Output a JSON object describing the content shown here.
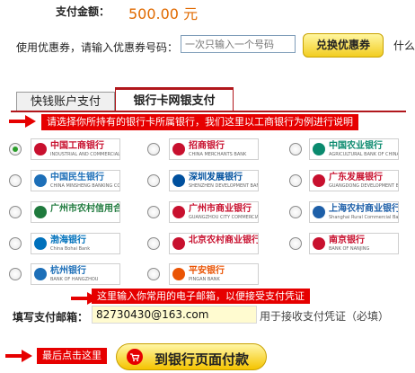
{
  "payment": {
    "label": "支付金额：",
    "amount": "500.00  元"
  },
  "coupon": {
    "label": "使用优惠券，请输入优惠券号码：",
    "placeholder": "一次只输入一个号码",
    "button": "兑换优惠券",
    "more": "什么"
  },
  "tabs": [
    {
      "label": "快钱账户支付"
    },
    {
      "label": "银行卡网银支付"
    }
  ],
  "banners": {
    "choose_bank": "请选择你所持有的银行卡所属银行，我们这里以工商银行为例进行说明",
    "email_tip": "这里输入你常用的电子邮箱，以便接受支付凭证",
    "final_click": "最后点击这里"
  },
  "banks": [
    {
      "name": "中国工商银行",
      "en": "INDUSTRIAL AND COMMERCIAL BANK OF CHINA",
      "color": "#c8102e",
      "selected": true
    },
    {
      "name": "招商银行",
      "en": "CHINA MERCHANTS BANK",
      "color": "#c8102e",
      "selected": false
    },
    {
      "name": "中国农业银行",
      "en": "AGRICULTURAL BANK OF CHINA",
      "color": "#0a8a6e",
      "selected": false
    },
    {
      "name": "中国民生银行",
      "en": "CHINA MINSHENG BANKING CORP., LTD",
      "color": "#1d6fb8",
      "selected": false
    },
    {
      "name": "深圳发展银行",
      "en": "SHENZHEN DEVELOPMENT BANK",
      "color": "#00509e",
      "selected": false
    },
    {
      "name": "广东发展银行",
      "en": "GUANGDONG DEVELOPMENT BANK",
      "color": "#c8102e",
      "selected": false
    },
    {
      "name": "广州市农村信用合作社",
      "en": "",
      "color": "#1f7a3d",
      "selected": false
    },
    {
      "name": "广州市商业银行",
      "en": "GUANGZHOU CITY COMMERCIAL BANK",
      "color": "#c8102e",
      "selected": false
    },
    {
      "name": "上海农村商业银行",
      "en": "Shanghai Rural Commercial Bank",
      "color": "#1d5fa8",
      "selected": false
    },
    {
      "name": "渤海银行",
      "en": "China Bohai Bank",
      "color": "#0071bc",
      "selected": false
    },
    {
      "name": "北京农村商业银行",
      "en": "",
      "color": "#c8102e",
      "selected": false
    },
    {
      "name": "南京银行",
      "en": "BANK OF NANJING",
      "color": "#c8102e",
      "selected": false
    },
    {
      "name": "杭州银行",
      "en": "BANK OF HANGZHOU",
      "color": "#1d6fb8",
      "selected": false
    },
    {
      "name": "平安银行",
      "en": "PINGAN BANK",
      "color": "#ea5404",
      "selected": false
    }
  ],
  "email": {
    "label": "填写支付邮箱：",
    "value": "82730430@163.com",
    "hint": "用于接收支付凭证（必填）"
  },
  "submit": {
    "label": "到银行页面付款"
  }
}
